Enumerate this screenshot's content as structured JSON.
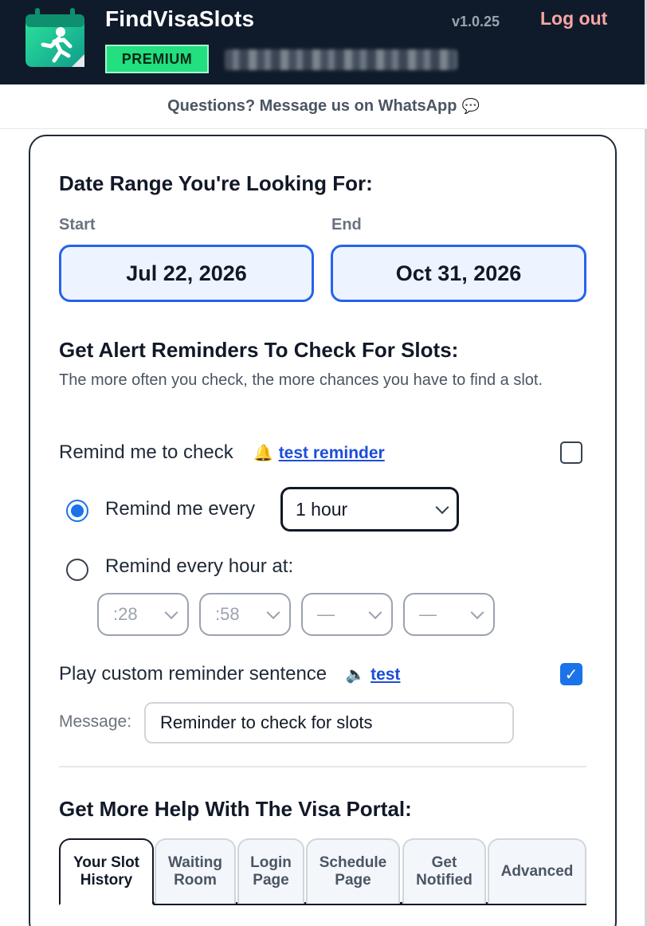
{
  "header": {
    "app_name": "FindVisaSlots",
    "badge": "PREMIUM",
    "version": "v1.0.25",
    "logout_label": "Log out",
    "logo_icon": "runner-calendar-icon",
    "colors": {
      "background": "#0f1b2b",
      "badge": "#22e07f",
      "logout": "#f8a5a5"
    }
  },
  "whatsapp": {
    "text": "Questions? Message us on WhatsApp",
    "icon": "speech-bubble-icon"
  },
  "date_range": {
    "heading": "Date Range You're Looking For:",
    "start_label": "Start",
    "start_value": "Jul 22, 2026",
    "end_label": "End",
    "end_value": "Oct 31, 2026"
  },
  "alerts": {
    "heading": "Get Alert Reminders To Check For Slots:",
    "description": "The more often you check, the more chances you have to find a slot.",
    "remind_label": "Remind me to check",
    "test_reminder_link": "test reminder",
    "remind_checked": false,
    "remind_every_label": "Remind me every",
    "remind_every_value": "1 hour",
    "remind_every_selected": true,
    "remind_hour_label": "Remind every hour at:",
    "minute_selects": [
      ":28",
      ":58",
      "—",
      "—"
    ],
    "custom_sentence_label": "Play custom reminder sentence",
    "custom_test_link": "test",
    "custom_checked": true,
    "message_label": "Message:",
    "message_value": "Reminder to check for slots"
  },
  "help": {
    "heading": "Get More Help With The Visa Portal:",
    "tabs": [
      "Your Slot\nHistory",
      "Waiting\nRoom",
      "Login\nPage",
      "Schedule\nPage",
      "Get\nNotified",
      "Advanced"
    ],
    "active_tab": 0
  }
}
